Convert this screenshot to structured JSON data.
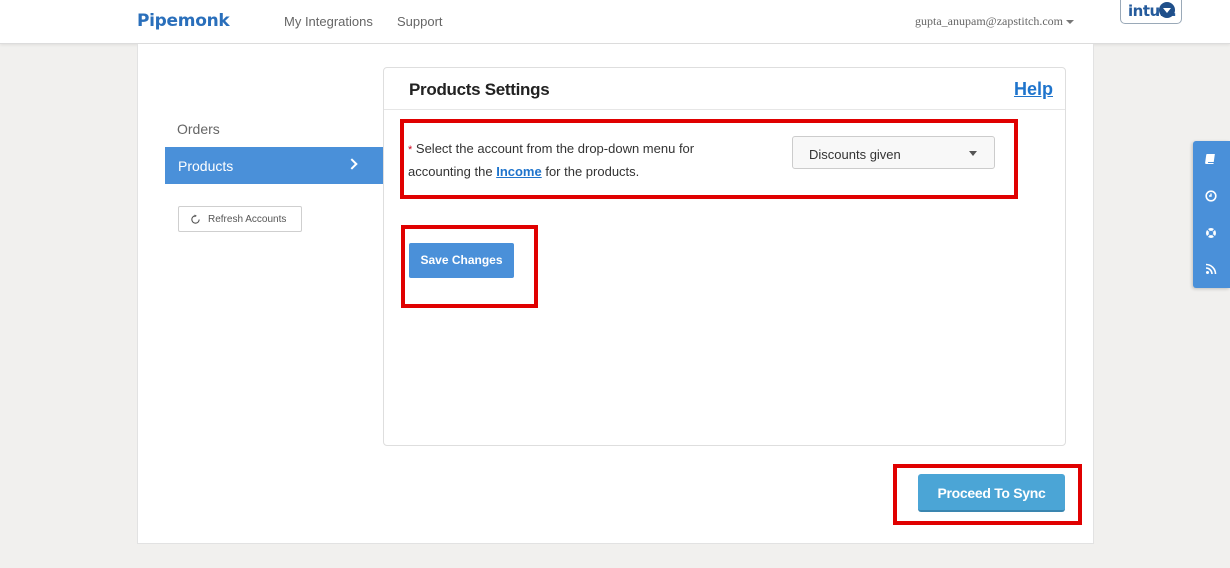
{
  "nav": {
    "brand": "Pipemonk",
    "links": [
      "My Integrations",
      "Support"
    ],
    "user_email": "gupta_anupam@zapstitch.com",
    "intuit_label": "intuit."
  },
  "sidebar": {
    "items": [
      {
        "label": "Orders",
        "active": false
      },
      {
        "label": "Products",
        "active": true
      }
    ],
    "refresh_label": "Refresh Accounts"
  },
  "panel": {
    "title": "Products Settings",
    "help_label": "Help",
    "required_marker": "*",
    "instruction_pre": "Select the account from the drop-down menu for accounting the",
    "instruction_link": "Income",
    "instruction_post": "for the products.",
    "select_value": "Discounts given",
    "save_label": "Save Changes"
  },
  "footer": {
    "proceed_label": "Proceed To Sync"
  },
  "side_tools": [
    "book-icon",
    "clock-icon",
    "lifebuoy-icon",
    "rss-icon"
  ],
  "colors": {
    "accent": "#4a90d9",
    "highlight": "#e00000",
    "proceed": "#4ba5d6"
  }
}
